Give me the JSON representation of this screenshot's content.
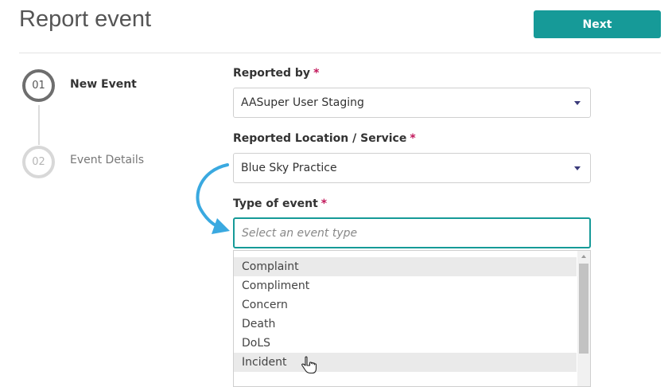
{
  "header": {
    "title": "Report event",
    "next_label": "Next"
  },
  "stepper": {
    "steps": [
      {
        "number": "01",
        "label": "New Event",
        "state": "active"
      },
      {
        "number": "02",
        "label": "Event Details",
        "state": "inactive"
      }
    ]
  },
  "form": {
    "required_marker": "*",
    "reported_by": {
      "label": "Reported by",
      "value": "AASuper User Staging"
    },
    "location": {
      "label": "Reported Location / Service",
      "value": "Blue Sky Practice"
    },
    "event_type": {
      "label": "Type of event",
      "placeholder": "Select an event type",
      "options": [
        "Complaint",
        "Compliment",
        "Concern",
        "Death",
        "DoLS",
        "Incident"
      ]
    }
  },
  "colors": {
    "accent": "#169a98",
    "required": "#c2185b",
    "annotation_arrow": "#3aa9e0"
  },
  "icons": [
    "chevron-down-icon",
    "curved-arrow-annotation",
    "hand-pointer-cursor"
  ]
}
